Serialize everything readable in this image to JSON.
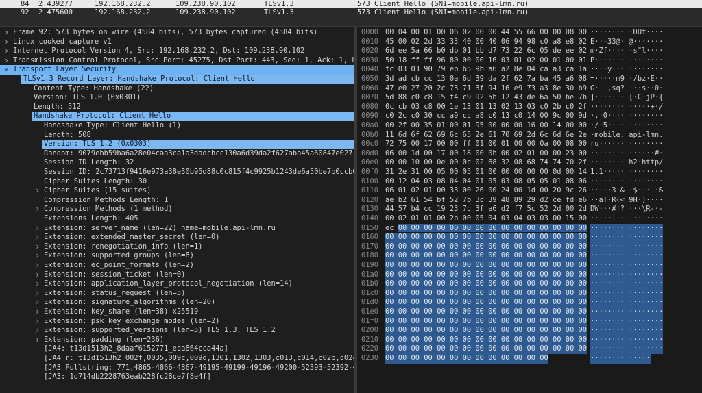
{
  "packet_list": [
    {
      "no": "84",
      "time": "2.439277",
      "src": "192.168.232.2",
      "dst": "109.238.90.102",
      "proto": "TLSv1.3",
      "len": "573",
      "info": "Client Hello (SNI=mobile.api-lmn.ru)",
      "selected": false
    },
    {
      "no": "92",
      "time": "2.475600",
      "src": "192.168.232.2",
      "dst": "109.238.90.102",
      "proto": "TLSv1.3",
      "len": "573",
      "info": "Client Hello (SNI=mobile.api-lmn.ru)",
      "selected": true
    }
  ],
  "details": [
    {
      "indent": 0,
      "arrow": "right",
      "text": "Frame 92: 573 bytes on wire (4584 bits), 573 bytes captured (4584 bits)"
    },
    {
      "indent": 0,
      "arrow": "right",
      "text": "Linux cooked capture v1"
    },
    {
      "indent": 0,
      "arrow": "right",
      "text": "Internet Protocol Version 4, Src: 192.168.232.2, Dst: 109.238.90.102"
    },
    {
      "indent": 0,
      "arrow": "right",
      "text": "Transmission Control Protocol, Src Port: 45275, Dst Port: 443, Seq: 1, Ack: 1, Len: 5"
    },
    {
      "indent": 0,
      "arrow": "down",
      "text": "Transport Layer Security",
      "hl": "full"
    },
    {
      "indent": 1,
      "arrow": "down",
      "text": "TLSv1.3 Record Layer: Handshake Protocol: Client Hello",
      "hl": "full"
    },
    {
      "indent": 2,
      "arrow": "",
      "text": "Content Type: Handshake (22)"
    },
    {
      "indent": 2,
      "arrow": "",
      "text": "Version: TLS 1.0 (0x0301)"
    },
    {
      "indent": 2,
      "arrow": "",
      "text": "Length: 512"
    },
    {
      "indent": 2,
      "arrow": "down",
      "text": "Handshake Protocol: Client Hello",
      "hl": "full"
    },
    {
      "indent": 3,
      "arrow": "",
      "text": "Handshake Type: Client Hello (1)"
    },
    {
      "indent": 3,
      "arrow": "",
      "text": "Length: 508"
    },
    {
      "indent": 3,
      "arrow": "right",
      "text": "Version: TLS 1.2 (0x0303)",
      "hl": "full"
    },
    {
      "indent": 3,
      "arrow": "",
      "text": "Random: 9079ebb59ba6a28e04caa3ca1a3dadcbcc130a6d39da2f627aba45a60847e027"
    },
    {
      "indent": 3,
      "arrow": "",
      "text": "Session ID Length: 32"
    },
    {
      "indent": 3,
      "arrow": "",
      "text": "Session ID: 2c73713f9416e973a38e30b95d88c0c815f4c9925b1243de6a50be7b0ccb03c8"
    },
    {
      "indent": 3,
      "arrow": "",
      "text": "Cipher Suites Length: 30"
    },
    {
      "indent": 3,
      "arrow": "right",
      "text": "Cipher Suites (15 suites)"
    },
    {
      "indent": 3,
      "arrow": "",
      "text": "Compression Methods Length: 1"
    },
    {
      "indent": 3,
      "arrow": "right",
      "text": "Compression Methods (1 method)"
    },
    {
      "indent": 3,
      "arrow": "",
      "text": "Extensions Length: 405"
    },
    {
      "indent": 3,
      "arrow": "right",
      "text": "Extension: server_name (len=22) name=mobile.api-lmn.ru"
    },
    {
      "indent": 3,
      "arrow": "right",
      "text": "Extension: extended_master_secret (len=0)"
    },
    {
      "indent": 3,
      "arrow": "right",
      "text": "Extension: renegotiation_info (len=1)"
    },
    {
      "indent": 3,
      "arrow": "right",
      "text": "Extension: supported_groups (len=8)"
    },
    {
      "indent": 3,
      "arrow": "right",
      "text": "Extension: ec_point_formats (len=2)"
    },
    {
      "indent": 3,
      "arrow": "right",
      "text": "Extension: session_ticket (len=0)"
    },
    {
      "indent": 3,
      "arrow": "right",
      "text": "Extension: application_layer_protocol_negotiation (len=14)"
    },
    {
      "indent": 3,
      "arrow": "right",
      "text": "Extension: status_request (len=5)"
    },
    {
      "indent": 3,
      "arrow": "right",
      "text": "Extension: signature_algorithms (len=20)"
    },
    {
      "indent": 3,
      "arrow": "right",
      "text": "Extension: key_share (len=38) x25519"
    },
    {
      "indent": 3,
      "arrow": "right",
      "text": "Extension: psk_key_exchange_modes (len=2)"
    },
    {
      "indent": 3,
      "arrow": "right",
      "text": "Extension: supported_versions (len=5) TLS 1.3, TLS 1.2"
    },
    {
      "indent": 3,
      "arrow": "right",
      "text": "Extension: padding (len=236)"
    },
    {
      "indent": 3,
      "arrow": "",
      "text": "[JA4: t13d1513h2_8daaf6152771_eca864cca44a]"
    },
    {
      "indent": 3,
      "arrow": "",
      "text": "[JA4_r: t13d1513h2_002f,0035,009c,009d,1301,1302,1303,c013,c014,c02b,c02c,c02"
    },
    {
      "indent": 3,
      "arrow": "",
      "text": "[JA3 Fullstring: 771,4865-4866-4867-49195-49199-49196-49200-52393-52392-49171-"
    },
    {
      "indent": 3,
      "arrow": "",
      "text": "[JA3: 1d714db2228763eab228fc28ce7f8e4f]"
    }
  ],
  "hex_rows": [
    {
      "off": "0000",
      "bytes": "00 04 00 01 00 06 02 00  00 44 55 66 00 00 08 00",
      "ascii": "········ ·DUf····"
    },
    {
      "off": "0010",
      "bytes": "45 00 02 2d 33 33 40 00  40 06 94 98 c0 a8 e8 02",
      "ascii": "E··-33@· @·······"
    },
    {
      "off": "0020",
      "bytes": "6d ee 5a 66 b0 db 01 bb  d7 73 22 6c 05 de ee 02",
      "ascii": "m·Zf···· ·s\"l····"
    },
    {
      "off": "0030",
      "bytes": "50 18 ff ff 96 80 00 00  16 03 01 02 00 01 00 01",
      "ascii": "P······· ········"
    },
    {
      "off": "0040",
      "bytes": "fc 03 03 90 79 eb b5 9b  a6 a2 8e 04 ca a3 ca 1a",
      "ascii": "····y··· ········"
    },
    {
      "off": "0050",
      "bytes": "3d ad cb cc 13 0a 6d 39  da 2f 62 7a ba 45 a6 08",
      "ascii": "=·····m9 ·/bz·E··"
    },
    {
      "off": "0060",
      "bytes": "47 e0 27 20 2c 73 71 3f  94 16 e9 73 a3 8e 30 b9",
      "ascii": "G·' ,sq? ···s··0·"
    },
    {
      "off": "0070",
      "bytes": "5d 88 c0 c8 15 f4 c9 92  5b 12 43 de 6a 50 be 7b",
      "ascii": "]······· [·C·jP·{"
    },
    {
      "off": "0080",
      "bytes": "0c cb 03 c8 00 1e 13 01  13 02 13 03 c0 2b c0 2f",
      "ascii": "········ ·····+·/"
    },
    {
      "off": "0090",
      "bytes": "c0 2c c0 30 cc a9 cc a8  c0 13 c0 14 00 9c 00 9d",
      "ascii": "·,·0···· ········"
    },
    {
      "off": "00a0",
      "bytes": "00 2f 00 35 01 00 01 95  00 00 00 16 00 14 00 00",
      "ascii": "·/·5···· ········"
    },
    {
      "off": "00b0",
      "bytes": "11 6d 6f 62 69 6c 65 2e  61 70 69 2d 6c 6d 6e 2e",
      "ascii": "·mobile. api-lmn."
    },
    {
      "off": "00c0",
      "bytes": "72 75 00 17 00 00 ff 01  00 01 00 00 0a 00 08 00",
      "ascii": "ru······ ········"
    },
    {
      "off": "00d0",
      "bytes": "06 00 1d 00 17 00 18 00  0b 00 02 01 00 00 23 00",
      "ascii": "········ ······#·"
    },
    {
      "off": "00e0",
      "bytes": "00 00 10 00 0e 00 0c 02  68 32 08 68 74 74 70 2f",
      "ascii": "········ h2·http/"
    },
    {
      "off": "00f0",
      "bytes": "31 2e 31 00 05 00 05 01  00 00 00 00 00 0d 00 14",
      "ascii": "1.1····· ········"
    },
    {
      "off": "0100",
      "bytes": "00 12 04 03 08 04 04 01  05 03 08 05 05 01 08 06",
      "ascii": "········ ········"
    },
    {
      "off": "0110",
      "bytes": "06 01 02 01 00 33 00 26  00 24 00 1d 00 20 9c 26",
      "ascii": "·····3·& ·$··· ·&"
    },
    {
      "off": "0120",
      "bytes": "ae b2 61 54 bf 52 7b 3c  39 48 89 29 d2 ce fd e6",
      "ascii": "··aT·R{< 9H·)····"
    },
    {
      "off": "0130",
      "bytes": "44 57 b4 cc 19 23 7c 3f  a6 d2 f7 5c 52 2d 00 2d",
      "ascii": "DW···#|? ···\\R-·-"
    },
    {
      "off": "0140",
      "bytes": "00 02 01 01 00 2b 00 05  04 03 04 03 03 00 15 00",
      "ascii": "·····+·· ········"
    },
    {
      "off": "0150",
      "bytes": "ec 00 00 00 00 00 00 00  00 00 00 00 00 00 00 00",
      "ascii": "········ ········",
      "hl_from": 1
    },
    {
      "off": "0160",
      "bytes": "00 00 00 00 00 00 00 00  00 00 00 00 00 00 00 00",
      "ascii": "········ ········",
      "hl_from": 0
    },
    {
      "off": "0170",
      "bytes": "00 00 00 00 00 00 00 00  00 00 00 00 00 00 00 00",
      "ascii": "········ ········",
      "hl_from": 0
    },
    {
      "off": "0180",
      "bytes": "00 00 00 00 00 00 00 00  00 00 00 00 00 00 00 00",
      "ascii": "········ ········",
      "hl_from": 0
    },
    {
      "off": "0190",
      "bytes": "00 00 00 00 00 00 00 00  00 00 00 00 00 00 00 00",
      "ascii": "········ ········",
      "hl_from": 0
    },
    {
      "off": "01a0",
      "bytes": "00 00 00 00 00 00 00 00  00 00 00 00 00 00 00 00",
      "ascii": "········ ········",
      "hl_from": 0
    },
    {
      "off": "01b0",
      "bytes": "00 00 00 00 00 00 00 00  00 00 00 00 00 00 00 00",
      "ascii": "········ ········",
      "hl_from": 0
    },
    {
      "off": "01c0",
      "bytes": "00 00 00 00 00 00 00 00  00 00 00 00 00 00 00 00",
      "ascii": "········ ········",
      "hl_from": 0
    },
    {
      "off": "01d0",
      "bytes": "00 00 00 00 00 00 00 00  00 00 00 00 00 00 00 00",
      "ascii": "········ ········",
      "hl_from": 0
    },
    {
      "off": "01e0",
      "bytes": "00 00 00 00 00 00 00 00  00 00 00 00 00 00 00 00",
      "ascii": "········ ········",
      "hl_from": 0
    },
    {
      "off": "01f0",
      "bytes": "00 00 00 00 00 00 00 00  00 00 00 00 00 00 00 00",
      "ascii": "········ ········",
      "hl_from": 0
    },
    {
      "off": "0200",
      "bytes": "00 00 00 00 00 00 00 00  00 00 00 00 00 00 00 00",
      "ascii": "········ ········",
      "hl_from": 0
    },
    {
      "off": "0210",
      "bytes": "00 00 00 00 00 00 00 00  00 00 00 00 00 00 00 00",
      "ascii": "········ ········",
      "hl_from": 0
    },
    {
      "off": "0220",
      "bytes": "00 00 00 00 00 00 00 00  00 00 00 00 00 00 00 00",
      "ascii": "········ ········",
      "hl_from": 0
    },
    {
      "off": "0230",
      "bytes": "00 00 00 00 00 00 00 00  00 00 00 00 00",
      "ascii": "········ ·····",
      "hl_from": 0
    }
  ],
  "colors": {
    "highlight": "#6fb2f2",
    "hex_highlight": "#2f5a8f",
    "background": "#1e1e1e"
  }
}
